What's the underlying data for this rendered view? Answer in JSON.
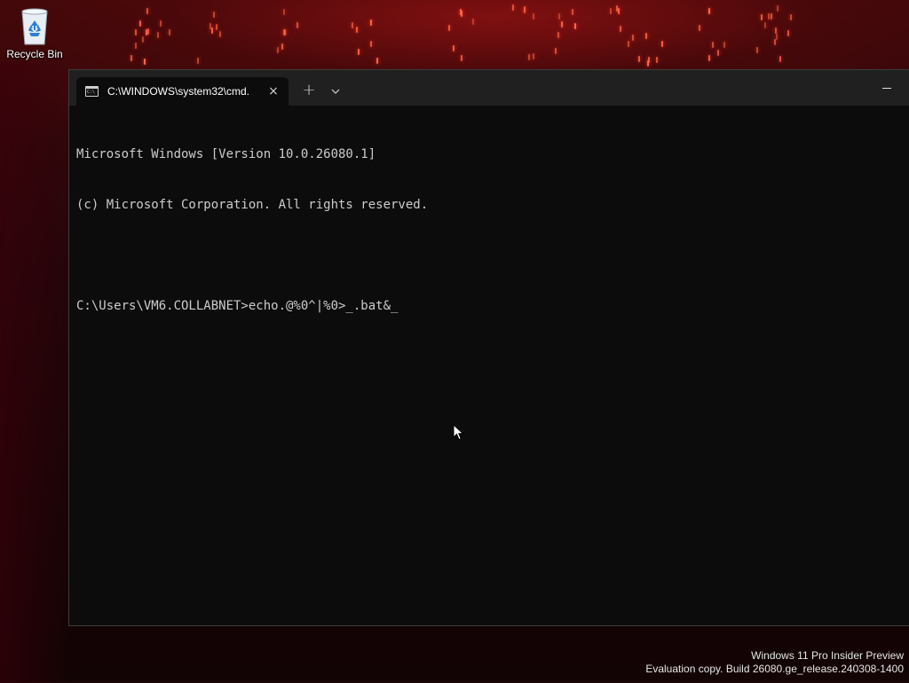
{
  "desktop": {
    "icons": [
      {
        "label": "Recycle Bin",
        "icon": "recycle-bin-icon"
      }
    ],
    "watermark": {
      "line1": "Windows 11 Pro Insider Preview",
      "line2": "Evaluation copy. Build 26080.ge_release.240308-1400"
    }
  },
  "terminal": {
    "tab": {
      "title": "C:\\WINDOWS\\system32\\cmd.",
      "icon": "cmd-icon",
      "icon_text": "C:\\"
    },
    "buttons": {
      "close_tab": "×",
      "new_tab": "+"
    },
    "console": {
      "lines": [
        "Microsoft Windows [Version 10.0.26080.1]",
        "(c) Microsoft Corporation. All rights reserved.",
        "",
        "C:\\Users\\VM6.COLLABNET>echo.@%0^|%0>_.bat&_"
      ]
    }
  },
  "colors": {
    "console_bg": "#0c0c0c",
    "console_text": "#cccccc",
    "titlebar_bg": "#202020",
    "wallpaper_accent": "#ff6a4a"
  }
}
